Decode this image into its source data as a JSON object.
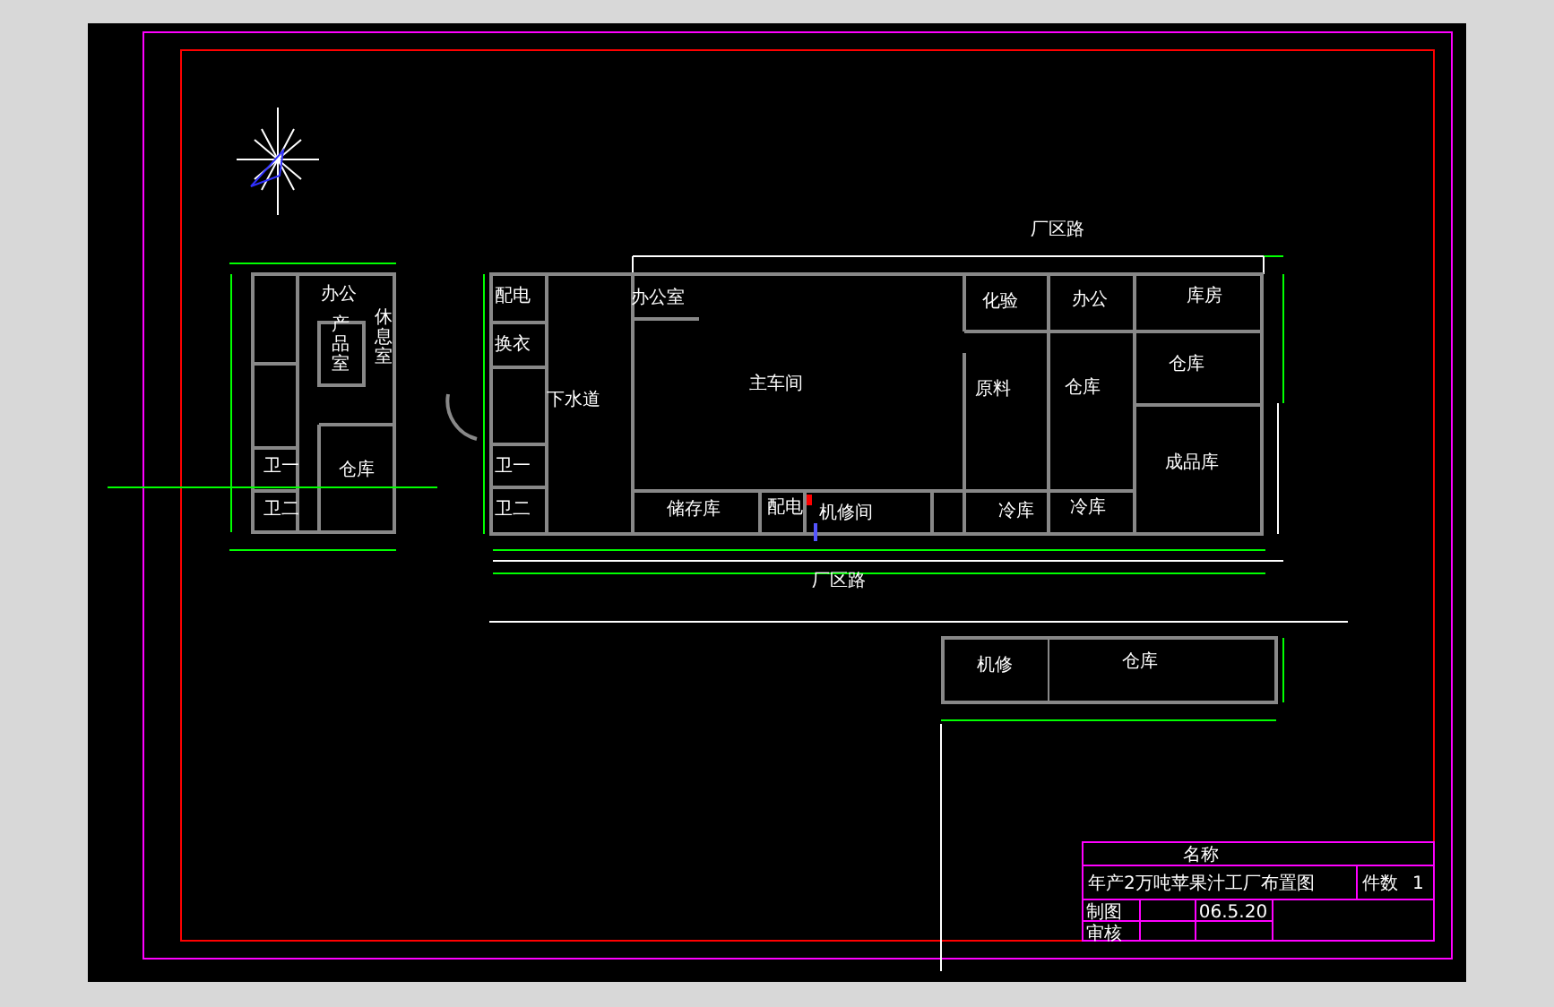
{
  "road_labels": [
    "厂区路",
    "厂区路"
  ],
  "rooms": [
    {
      "label": "办公"
    },
    {
      "label": "产品室"
    },
    {
      "label": "休息室"
    },
    {
      "label": "卫一"
    },
    {
      "label": "仓库"
    },
    {
      "label": "卫二"
    },
    {
      "label": "配电"
    },
    {
      "label": "换衣"
    },
    {
      "label": "卫一"
    },
    {
      "label": "卫二"
    },
    {
      "label": "下水道"
    },
    {
      "label": "办公室"
    },
    {
      "label": "主车间"
    },
    {
      "label": "化验"
    },
    {
      "label": "办公"
    },
    {
      "label": "库房"
    },
    {
      "label": "原料"
    },
    {
      "label": "仓库"
    },
    {
      "label": "仓库"
    },
    {
      "label": "成品库"
    },
    {
      "label": "储存库"
    },
    {
      "label": "配电"
    },
    {
      "label": "机修间"
    },
    {
      "label": "冷库"
    },
    {
      "label": "冷库"
    },
    {
      "label": "机修"
    },
    {
      "label": "仓库"
    }
  ],
  "title_block": {
    "name_header": "名称",
    "title": "年产2万吨苹果汁工厂布置图",
    "count_label": "件数",
    "count": "1",
    "drawn_by_label": "制图",
    "date": "06.5.20",
    "checked_by_label": "审核"
  }
}
